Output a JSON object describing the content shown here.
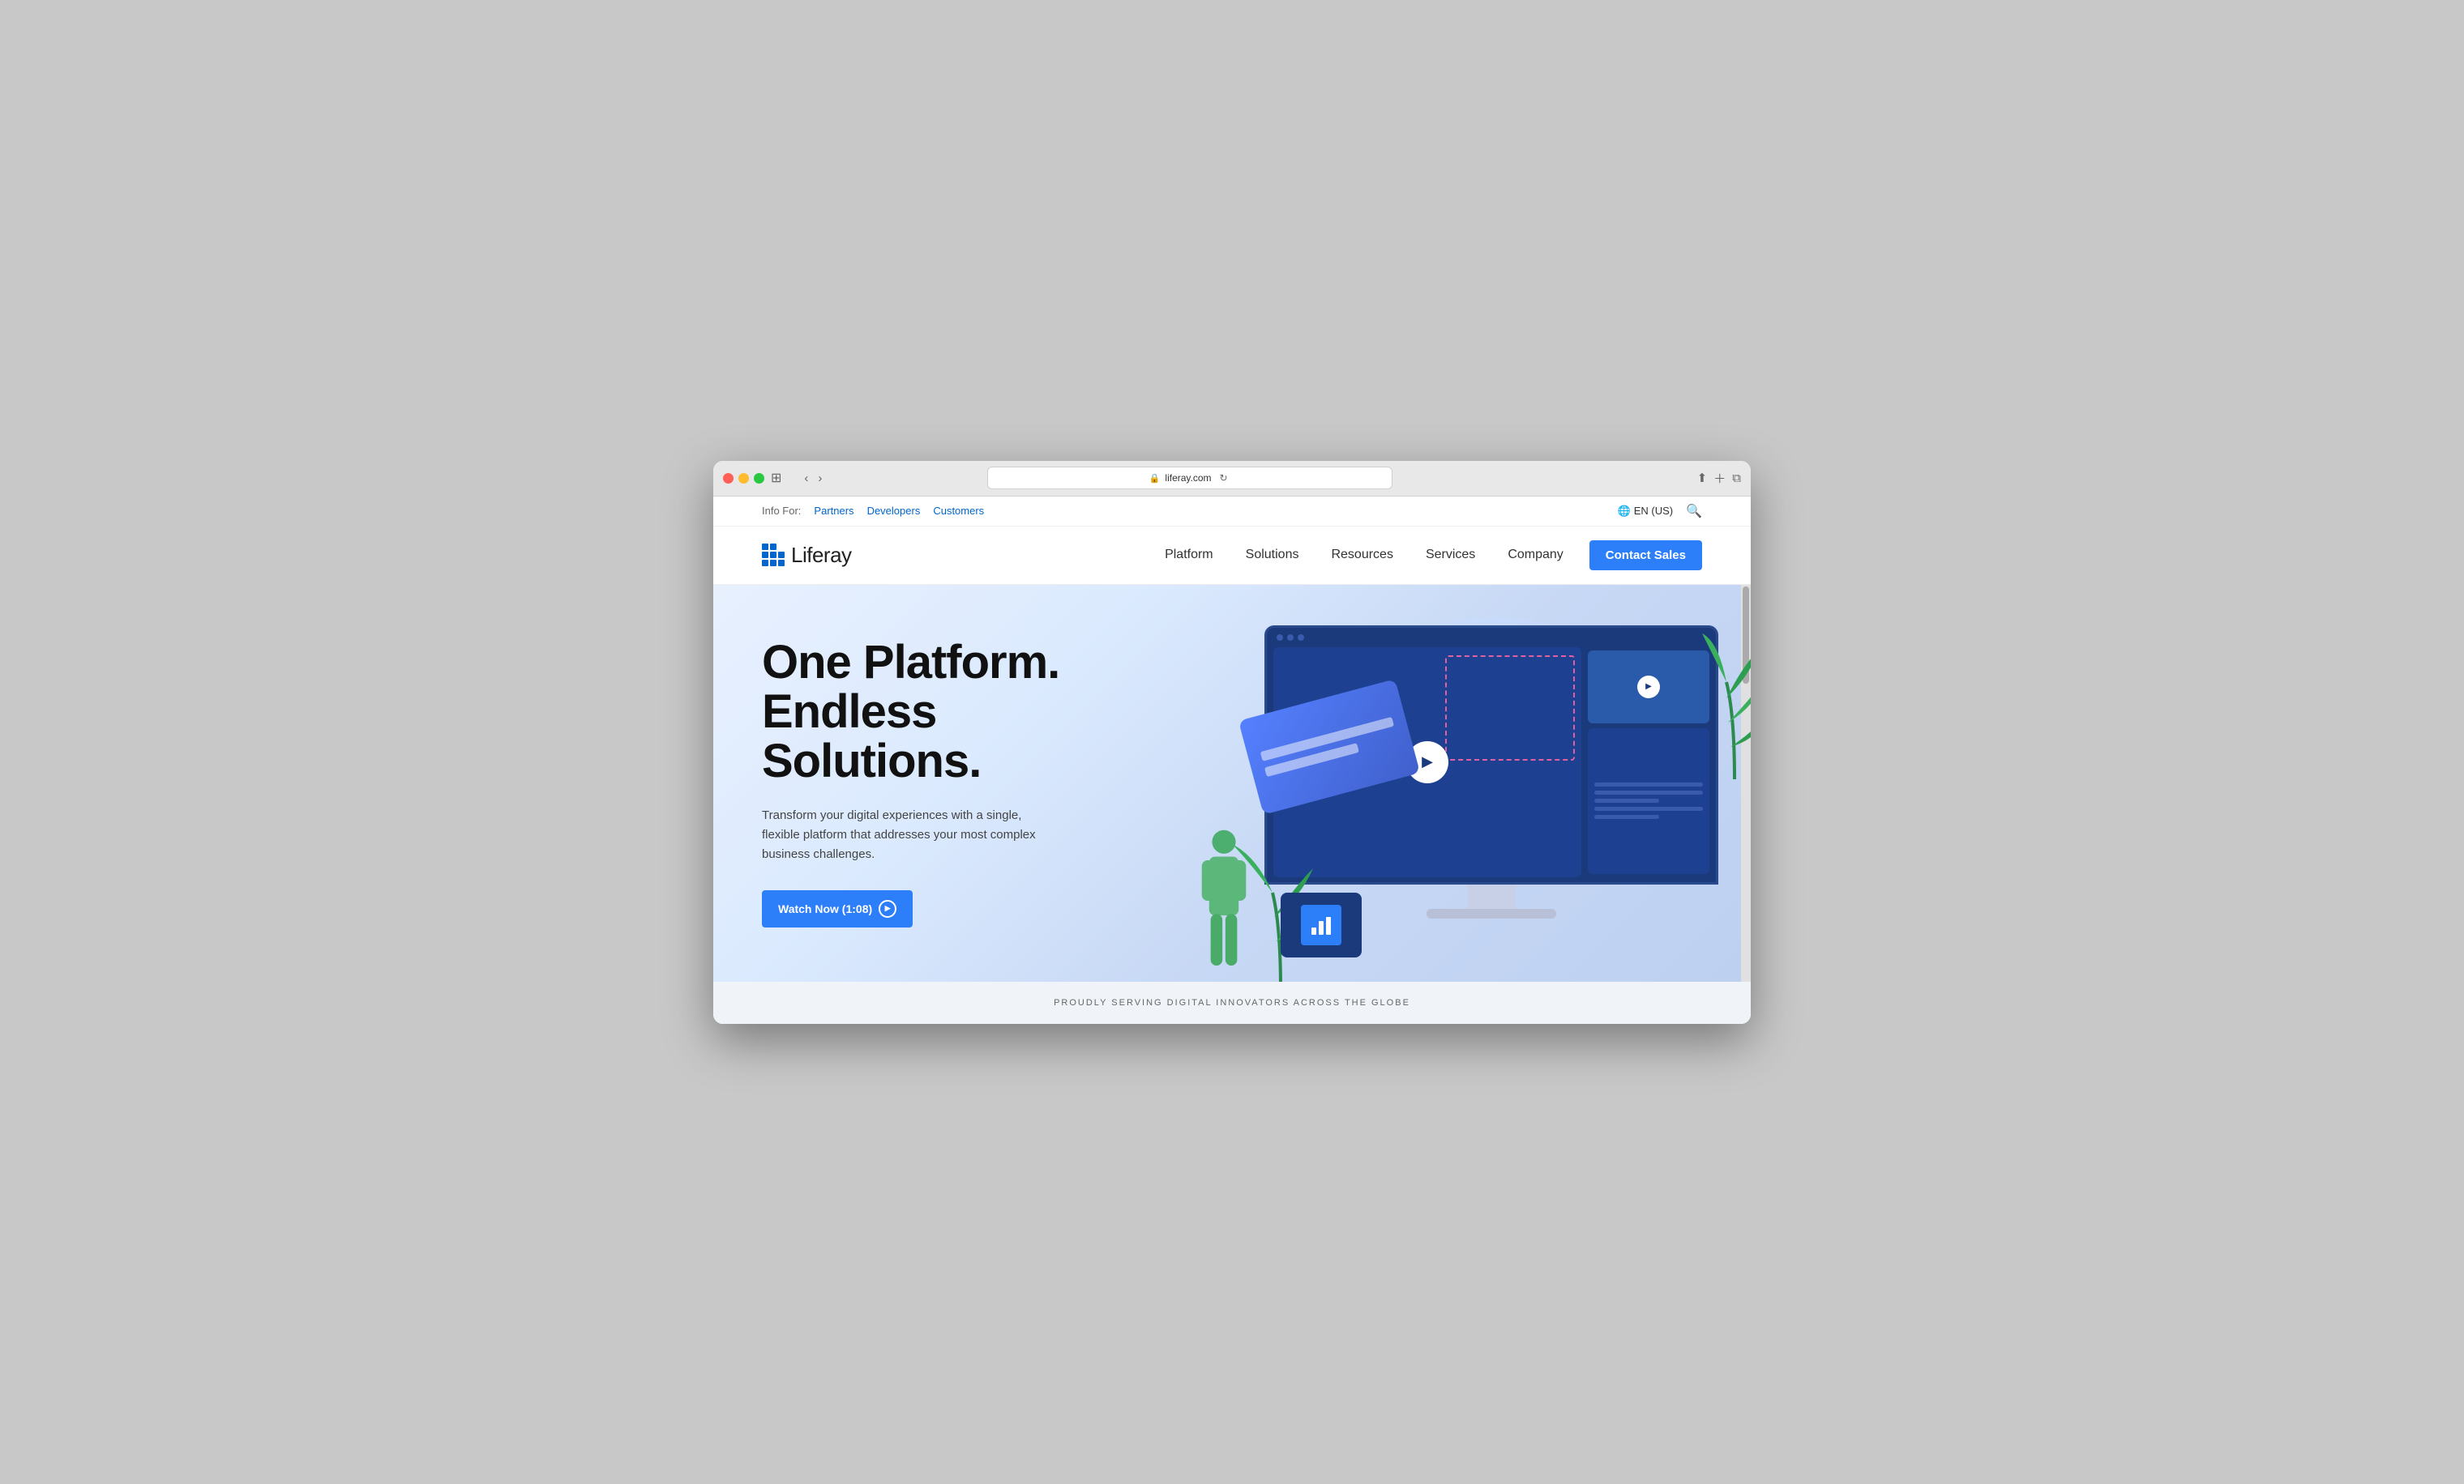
{
  "browser": {
    "url": "liferay.com",
    "traffic_lights": [
      "red",
      "yellow",
      "green"
    ]
  },
  "infobar": {
    "label": "Info For:",
    "links": [
      "Partners",
      "Developers",
      "Customers"
    ],
    "lang": "EN (US)",
    "lang_icon": "🌐"
  },
  "nav": {
    "logo_text": "Liferay",
    "links": [
      "Platform",
      "Solutions",
      "Resources",
      "Services",
      "Company"
    ],
    "cta_label": "Contact Sales"
  },
  "hero": {
    "title_line1": "One Platform.",
    "title_line2": "Endless Solutions.",
    "subtitle": "Transform your digital experiences with a single, flexible platform that addresses your most complex business challenges.",
    "watch_btn": "Watch Now (1:08)"
  },
  "footer": {
    "tagline": "PROUDLY SERVING DIGITAL INNOVATORS ACROSS THE GLOBE"
  }
}
